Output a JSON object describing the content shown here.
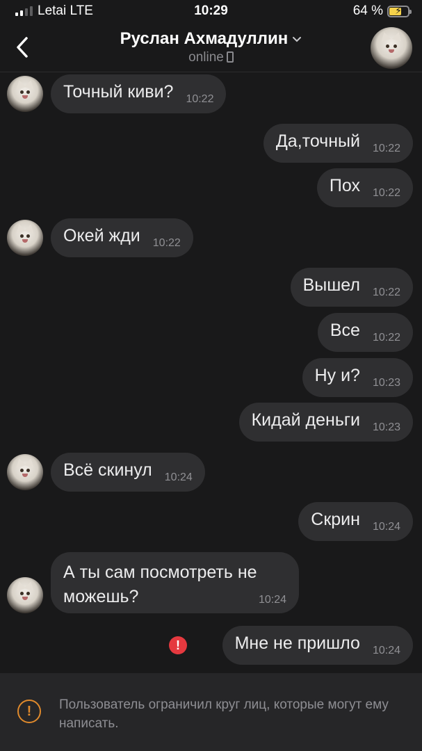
{
  "status_bar": {
    "carrier": "Letai",
    "network": "LTE",
    "time": "10:29",
    "battery": "64 %",
    "battery_level": 0.64
  },
  "header": {
    "contact_name": "Руслан Ахмадуллин",
    "status": "online"
  },
  "messages": [
    {
      "dir": "in",
      "text": "Точный киви?",
      "time": "10:22"
    },
    {
      "dir": "out",
      "text": "Да,точный",
      "time": "10:22"
    },
    {
      "dir": "out",
      "text": "Пох",
      "time": "10:22"
    },
    {
      "dir": "in",
      "text": "Окей жди",
      "time": "10:22"
    },
    {
      "dir": "out",
      "text": "Вышел",
      "time": "10:22"
    },
    {
      "dir": "out",
      "text": "Все",
      "time": "10:22"
    },
    {
      "dir": "out",
      "text": "Ну и?",
      "time": "10:23"
    },
    {
      "dir": "out",
      "text": "Кидай деньги",
      "time": "10:23"
    },
    {
      "dir": "in",
      "text": "Всё скинул",
      "time": "10:24"
    },
    {
      "dir": "out",
      "text": "Скрин",
      "time": "10:24"
    },
    {
      "dir": "in",
      "text_line1": "А ты сам посмотреть не",
      "text_line2": "можешь?",
      "time": "10:24"
    },
    {
      "dir": "out",
      "text": "Мне не пришло",
      "time": "10:24",
      "failed": true
    }
  ],
  "footer": {
    "notice": "Пользователь ограничил круг лиц, которые могут ему написать."
  },
  "colors": {
    "background": "#19191a",
    "bubble": "#2f2f31",
    "error": "#e5393f",
    "warning": "#e08a2c",
    "battery": "#f5d24a"
  }
}
